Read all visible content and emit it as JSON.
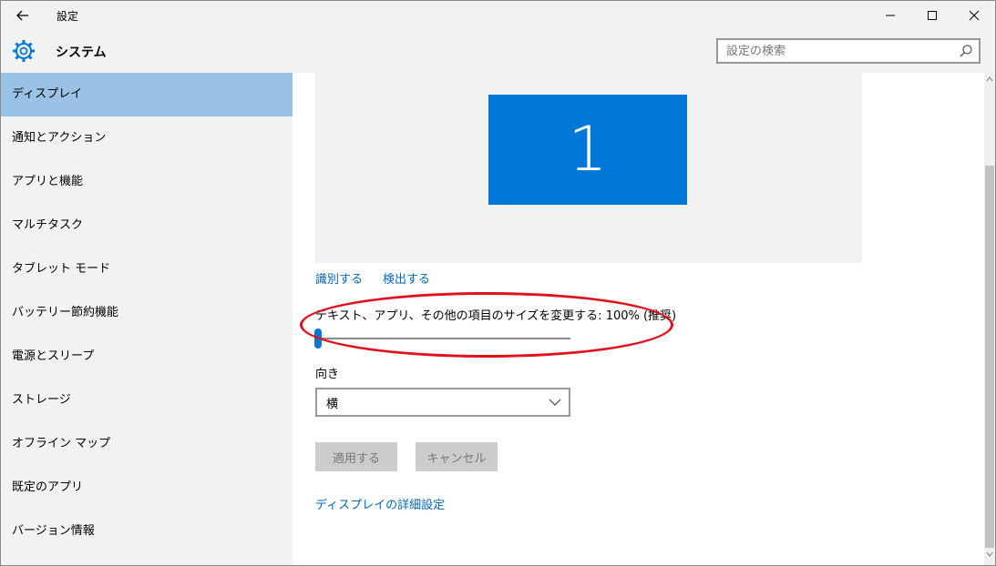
{
  "titlebar": {
    "title": "設定"
  },
  "header": {
    "title": "システム",
    "search_placeholder": "設定の検索"
  },
  "sidebar": {
    "items": [
      {
        "label": "ディスプレイ",
        "active": true
      },
      {
        "label": "通知とアクション"
      },
      {
        "label": "アプリと機能"
      },
      {
        "label": "マルチタスク"
      },
      {
        "label": "タブレット モード"
      },
      {
        "label": "バッテリー節約機能"
      },
      {
        "label": "電源とスリープ"
      },
      {
        "label": "ストレージ"
      },
      {
        "label": "オフライン マップ"
      },
      {
        "label": "既定のアプリ"
      },
      {
        "label": "バージョン情報"
      }
    ]
  },
  "display": {
    "monitor_number": "1",
    "identify_link": "識別する",
    "detect_link": "検出する",
    "scale_label": "テキスト、アプリ、その他の項目のサイズを変更する: 100% (推奨)",
    "scale_slider_value": 0,
    "orientation_label": "向き",
    "orientation_value": "横",
    "apply_button": "適用する",
    "cancel_button": "キャンセル",
    "advanced_link": "ディスプレイの詳細設定"
  },
  "colors": {
    "accent": "#0078d7",
    "link": "#0067b8",
    "active_nav": "#99c2e6",
    "highlight_annotation": "#e0101c"
  },
  "icons": {
    "back": "back-arrow-icon",
    "header": "gear-icon",
    "search": "search-icon",
    "dropdown": "chevron-down-icon"
  }
}
